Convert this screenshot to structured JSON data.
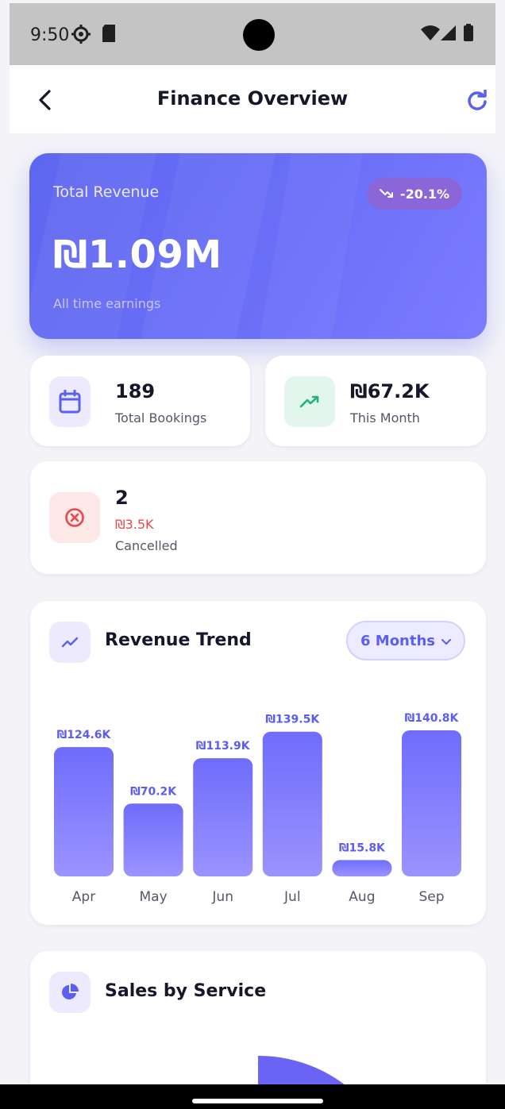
{
  "status_bar": {
    "time": "9:50"
  },
  "header": {
    "title": "Finance Overview"
  },
  "hero": {
    "label": "Total Revenue",
    "value": "₪1.09M",
    "subtitle": "All time earnings",
    "change": "-20.1%"
  },
  "stats": {
    "bookings": {
      "value": "189",
      "label": "Total Bookings"
    },
    "month": {
      "value": "₪67.2K",
      "label": "This Month"
    },
    "cancelled": {
      "value": "2",
      "amount": "₪3.5K",
      "label": "Cancelled"
    }
  },
  "revenue_trend": {
    "title": "Revenue Trend",
    "range": "6 Months"
  },
  "chart_data": {
    "type": "bar",
    "categories": [
      "Apr",
      "May",
      "Jun",
      "Jul",
      "Aug",
      "Sep"
    ],
    "values": [
      124.6,
      70.2,
      113.9,
      139.5,
      15.8,
      140.8
    ],
    "labels": [
      "₪124.6K",
      "₪70.2K",
      "₪113.9K",
      "₪139.5K",
      "₪15.8K",
      "₪140.8K"
    ],
    "title": "Revenue Trend",
    "ylim": [
      0,
      140.8
    ],
    "grid": false,
    "colors": {
      "top": "#6f6cfb",
      "bottom": "#9b93ff",
      "label": "#5c5df0",
      "tick": "#555866"
    }
  },
  "sales_by_service": {
    "title": "Sales by Service"
  },
  "colors": {
    "accent": "#5b5ff0",
    "danger": "#e5484d",
    "success": "#20b57a"
  }
}
